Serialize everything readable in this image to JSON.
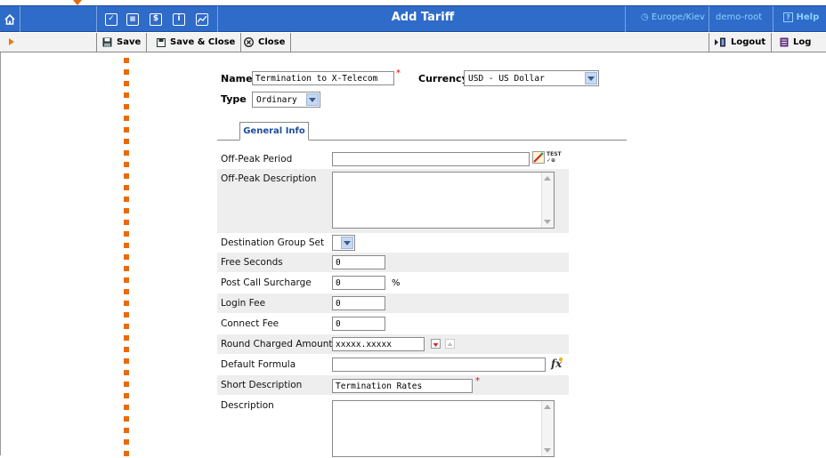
{
  "header": {
    "title": "Add Tariff",
    "timezone": "Europe/Kiev",
    "user": "demo-root",
    "help_label": "Help"
  },
  "toolbar": {
    "save_label": "Save",
    "save_close_label": "Save & Close",
    "close_label": "Close",
    "logout_label": "Logout",
    "log_label": "Log"
  },
  "form": {
    "name_label": "Name",
    "name_value": "Termination to X-Telecom",
    "currency_label": "Currency",
    "currency_value": "USD - US Dollar",
    "type_label": "Type",
    "type_value": "Ordinary"
  },
  "tabs": [
    {
      "label": "General Info",
      "active": true
    }
  ],
  "fields": {
    "off_peak_period": {
      "label": "Off-Peak Period",
      "value": ""
    },
    "off_peak_description": {
      "label": "Off-Peak Description",
      "value": ""
    },
    "destination_group_set": {
      "label": "Destination Group Set",
      "value": ""
    },
    "free_seconds": {
      "label": "Free Seconds",
      "value": "0"
    },
    "post_call_surcharge": {
      "label": "Post Call Surcharge",
      "value": "0",
      "unit": "%"
    },
    "login_fee": {
      "label": "Login Fee",
      "value": "0"
    },
    "connect_fee": {
      "label": "Connect Fee",
      "value": "0"
    },
    "round_charged_amount": {
      "label": "Round Charged Amount",
      "value": "xxxxx.xxxxx"
    },
    "default_formula": {
      "label": "Default Formula",
      "value": ""
    },
    "short_description": {
      "label": "Short Description",
      "value": "Termination Rates"
    },
    "description": {
      "label": "Description",
      "value": ""
    }
  },
  "icons": {
    "test_label": "TEST"
  },
  "colors": {
    "header_bg": "#2f6bc9",
    "accent_orange": "#e86a0c",
    "required": "#dd0000"
  }
}
